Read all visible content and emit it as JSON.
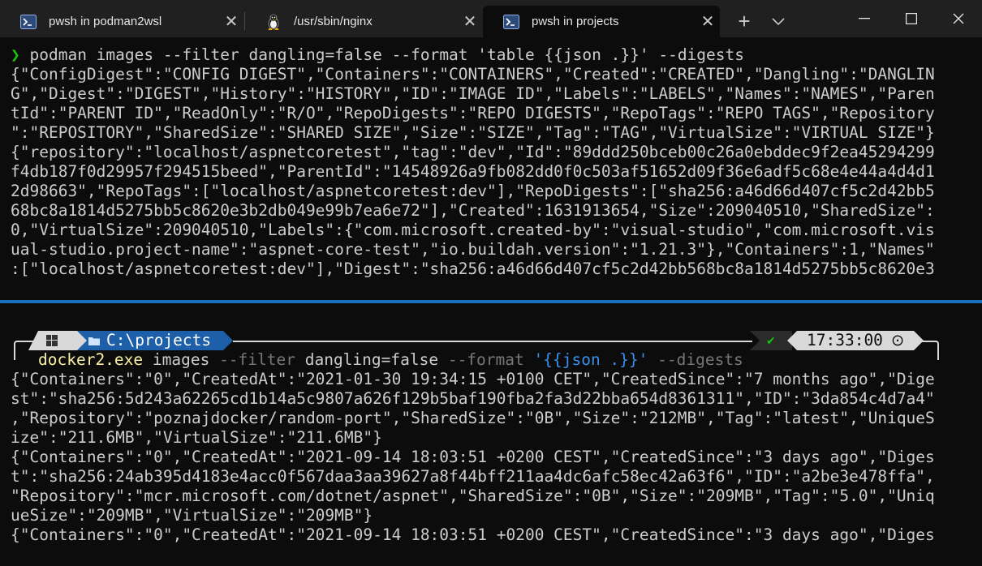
{
  "tabs": [
    {
      "label": "pwsh in podman2wsl",
      "icon": "powershell-icon",
      "active": false
    },
    {
      "label": "/usr/sbin/nginx",
      "icon": "linux-penguin-icon",
      "active": false
    },
    {
      "label": "pwsh in projects",
      "icon": "powershell-icon",
      "active": true
    }
  ],
  "tab_close_glyph": "✕",
  "new_tab_glyph": "+",
  "dropdown_glyph": "⌄",
  "window": {
    "minimize": "—",
    "maximize": "☐",
    "close": "✕"
  },
  "top_pane": {
    "prompt_symbol": "❯",
    "command": "podman images --filter dangling=false --format 'table {{json .}}' --digests",
    "output": [
      "{\"ConfigDigest\":\"CONFIG DIGEST\",\"Containers\":\"CONTAINERS\",\"Created\":\"CREATED\",\"Dangling\":\"DANGLIN",
      "G\",\"Digest\":\"DIGEST\",\"History\":\"HISTORY\",\"ID\":\"IMAGE ID\",\"Labels\":\"LABELS\",\"Names\":\"NAMES\",\"Paren",
      "tId\":\"PARENT ID\",\"ReadOnly\":\"R/O\",\"RepoDigests\":\"REPO DIGESTS\",\"RepoTags\":\"REPO TAGS\",\"Repository",
      "\":\"REPOSITORY\",\"SharedSize\":\"SHARED SIZE\",\"Size\":\"SIZE\",\"Tag\":\"TAG\",\"VirtualSize\":\"VIRTUAL SIZE\"}",
      "{\"repository\":\"localhost/aspnetcoretest\",\"tag\":\"dev\",\"Id\":\"89ddd250bceb00c26a0ebddec9f2ea45294299",
      "f4db187f0d29957f294515beed\",\"ParentId\":\"14548926a9fb082dd0f0c503af51652d09f36e6adf5c68e4e44a4d4d1",
      "2d98663\",\"RepoTags\":[\"localhost/aspnetcoretest:dev\"],\"RepoDigests\":[\"sha256:a46d66d407cf5c2d42bb5",
      "68bc8a1814d5275bb5c8620e3b2db049e99b7ea6e72\"],\"Created\":1631913654,\"Size\":209040510,\"SharedSize\":",
      "0,\"VirtualSize\":209040510,\"Labels\":{\"com.microsoft.created-by\":\"visual-studio\",\"com.microsoft.vis",
      "ual-studio.project-name\":\"aspnet-core-test\",\"io.buildah.version\":\"1.21.3\"},\"Containers\":1,\"Names\"",
      ":[\"localhost/aspnetcoretest:dev\"],\"Digest\":\"sha256:a46d66d407cf5c2d42bb568bc8a1814d5275bb5c8620e3"
    ]
  },
  "bottom_pane": {
    "prompt_path_icon": "folder-icon",
    "prompt_path": "C:\\projects",
    "status_check": "✔",
    "time": "17:33:00",
    "clock_glyph": "⊙",
    "command_parts": {
      "exe": "docker2.exe",
      "subcommand": " images ",
      "flag1": "--filter",
      "value1": " dangling=false ",
      "flag2": "--format",
      "space": " ",
      "value2": "'{{json .}}'",
      "space2": " ",
      "flag3": "--digests"
    },
    "output": [
      "{\"Containers\":\"0\",\"CreatedAt\":\"2021-01-30 19:34:15 +0100 CET\",\"CreatedSince\":\"7 months ago\",\"Dige",
      "st\":\"sha256:5d243a62265cd1b14a5c9807a626f129b5baf190fba2fa3d22bba654d8361311\",\"ID\":\"3da854c4d7a4\"",
      ",\"Repository\":\"poznajdocker/random-port\",\"SharedSize\":\"0B\",\"Size\":\"212MB\",\"Tag\":\"latest\",\"UniqueS",
      "ize\":\"211.6MB\",\"VirtualSize\":\"211.6MB\"}",
      "{\"Containers\":\"0\",\"CreatedAt\":\"2021-09-14 18:03:51 +0200 CEST\",\"CreatedSince\":\"3 days ago\",\"Diges",
      "t\":\"sha256:24ab395d4183e4acc0f567daa3aa39627a8f44bff211aa4dc6afc58ec42a63f6\",\"ID\":\"a2be3e478ffa\",",
      "\"Repository\":\"mcr.microsoft.com/dotnet/aspnet\",\"SharedSize\":\"0B\",\"Size\":\"209MB\",\"Tag\":\"5.0\",\"Uniq",
      "ueSize\":\"209MB\",\"VirtualSize\":\"209MB\"}",
      "{\"Containers\":\"0\",\"CreatedAt\":\"2021-09-14 18:03:51 +0200 CEST\",\"CreatedSince\":\"3 days ago\",\"Diges"
    ]
  }
}
